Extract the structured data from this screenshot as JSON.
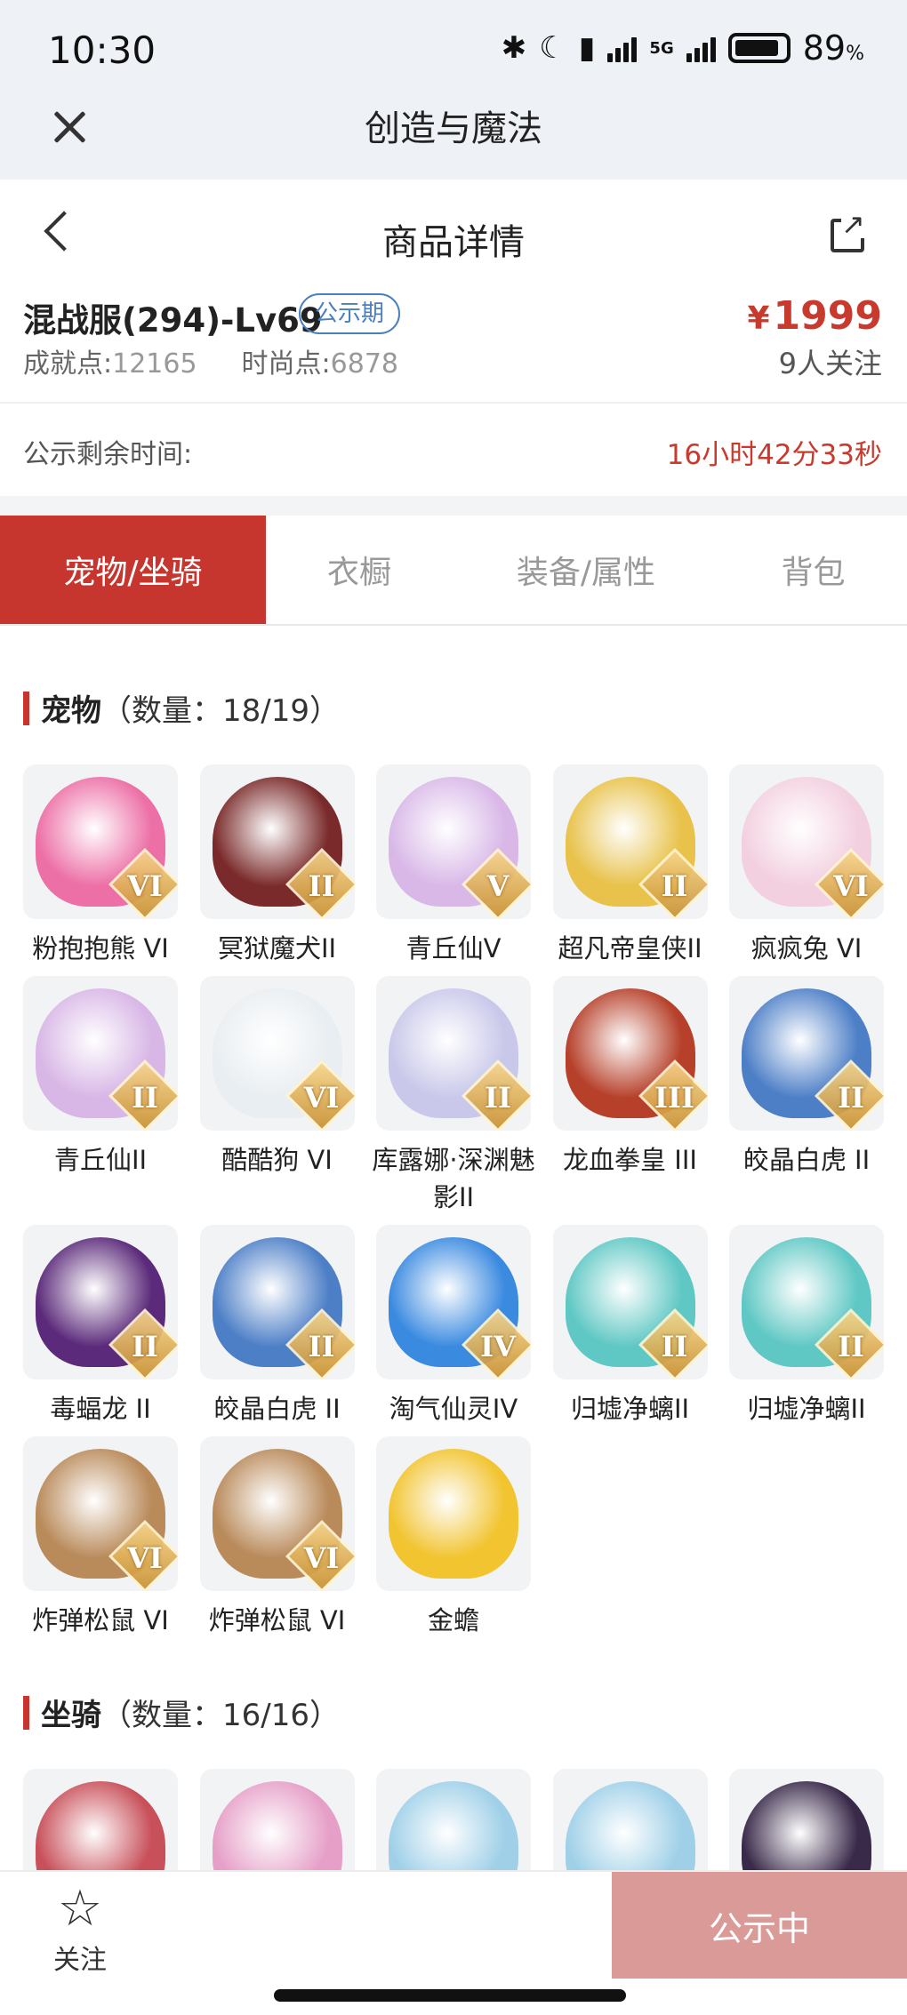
{
  "status_bar": {
    "time": "10:30",
    "network": "5G",
    "battery": "89",
    "battery_unit": "%"
  },
  "app": {
    "title": "创造与魔法",
    "close_label": "×"
  },
  "page": {
    "title": "商品详情"
  },
  "product": {
    "server": "混战服(294)-Lv69",
    "badge": "公示期",
    "price_symbol": "¥",
    "price": "1999",
    "achievement_label": "成就点:",
    "achievement": "12165",
    "fashion_label": "时尚点:",
    "fashion": "6878",
    "follows": "9人关注"
  },
  "remaining": {
    "label": "公示剩余时间:",
    "value": "16小时42分33秒"
  },
  "tabs": [
    "宠物/坐骑",
    "衣橱",
    "装备/属性",
    "背包"
  ],
  "pets": {
    "title": "宠物",
    "count": "（数量：18/19）",
    "items": [
      {
        "name": "粉抱抱熊 VI",
        "rank": "VI",
        "color": "#ec6fa6"
      },
      {
        "name": "冥狱魔犬II",
        "rank": "II",
        "color": "#7a2a2a"
      },
      {
        "name": "青丘仙V",
        "rank": "V",
        "color": "#d9b8e8"
      },
      {
        "name": "超凡帝皇侠II",
        "rank": "II",
        "color": "#e8c24a"
      },
      {
        "name": "疯疯兔 VI",
        "rank": "VI",
        "color": "#f3d0e0"
      },
      {
        "name": "青丘仙II",
        "rank": "II",
        "color": "#d8b6e6"
      },
      {
        "name": "酷酷狗 VI",
        "rank": "VI",
        "color": "#e9eef2"
      },
      {
        "name": "库露娜·深渊魅影II",
        "rank": "II",
        "color": "#c9c8ea"
      },
      {
        "name": "龙血拳皇 III",
        "rank": "III",
        "color": "#b6402a"
      },
      {
        "name": "皎晶白虎 II",
        "rank": "II",
        "color": "#4d7fc7"
      },
      {
        "name": "毒蝠龙 II",
        "rank": "II",
        "color": "#5b2a7a"
      },
      {
        "name": "皎晶白虎 II",
        "rank": "II",
        "color": "#4d7fc7"
      },
      {
        "name": "淘气仙灵IV",
        "rank": "IV",
        "color": "#3a8ae0"
      },
      {
        "name": "归墟净螭II",
        "rank": "II",
        "color": "#5fc8c4"
      },
      {
        "name": "归墟净螭II",
        "rank": "II",
        "color": "#5fc8c4"
      },
      {
        "name": "炸弹松鼠 VI",
        "rank": "VI",
        "color": "#b98a5a"
      },
      {
        "name": "炸弹松鼠 VI",
        "rank": "VI",
        "color": "#b98a5a"
      },
      {
        "name": "金蟾",
        "rank": "",
        "color": "#f2c430"
      }
    ]
  },
  "mounts": {
    "title": "坐骑",
    "count": "（数量：16/16）",
    "items": [
      {
        "color": "#c8505a"
      },
      {
        "color": "#e6a0c8"
      },
      {
        "color": "#9fd0e8"
      },
      {
        "color": "#9fd0e8"
      },
      {
        "color": "#3a2a4a"
      }
    ]
  },
  "bottom_bar": {
    "follow_label": "关注",
    "cta_label": "公示中"
  },
  "colors": {
    "accent": "#c7362e",
    "price": "#c8392e",
    "badge": "#4a7fc0",
    "cta": "#d99a98"
  }
}
